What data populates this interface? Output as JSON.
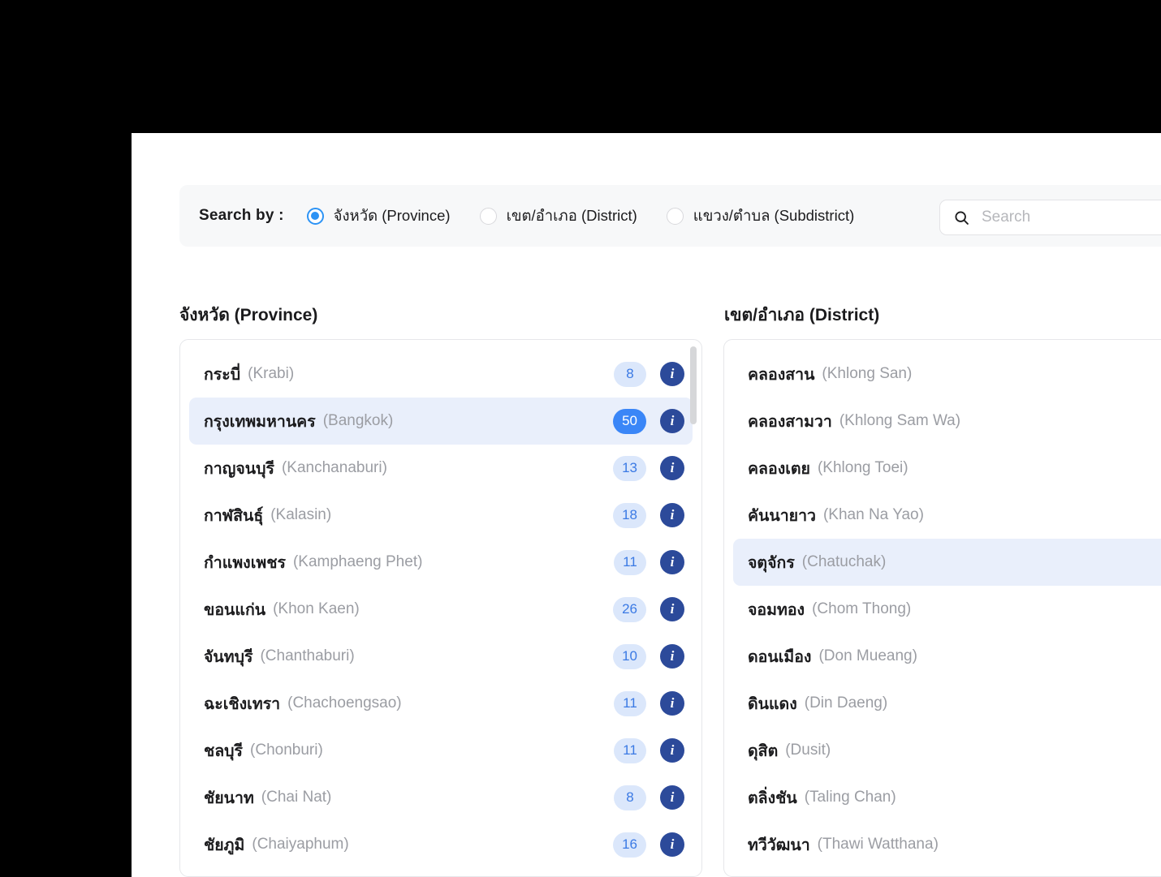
{
  "filter_bar": {
    "search_by_label": "Search by :",
    "options": [
      {
        "label": "จังหวัด (Province)",
        "checked": true
      },
      {
        "label": "เขต/อำเภอ (District)",
        "checked": false
      },
      {
        "label": "แขวง/ตำบล (Subdistrict)",
        "checked": false
      }
    ],
    "search": {
      "icon": "search-icon",
      "value": "",
      "placeholder": "Search"
    }
  },
  "province_column": {
    "title": "จังหวัด (Province)",
    "items": [
      {
        "th": "กระบี่",
        "en": "(Krabi)",
        "count": "8",
        "selected": false
      },
      {
        "th": "กรุงเทพมหานคร",
        "en": "(Bangkok)",
        "count": "50",
        "selected": true
      },
      {
        "th": "กาญจนบุรี",
        "en": "(Kanchanaburi)",
        "count": "13",
        "selected": false
      },
      {
        "th": "กาฬสินธุ์",
        "en": "(Kalasin)",
        "count": "18",
        "selected": false
      },
      {
        "th": "กำแพงเพชร",
        "en": "(Kamphaeng Phet)",
        "count": "11",
        "selected": false
      },
      {
        "th": "ขอนแก่น",
        "en": "(Khon Kaen)",
        "count": "26",
        "selected": false
      },
      {
        "th": "จันทบุรี",
        "en": "(Chanthaburi)",
        "count": "10",
        "selected": false
      },
      {
        "th": "ฉะเชิงเทรา",
        "en": "(Chachoengsao)",
        "count": "11",
        "selected": false
      },
      {
        "th": "ชลบุรี",
        "en": "(Chonburi)",
        "count": "11",
        "selected": false
      },
      {
        "th": "ชัยนาท",
        "en": "(Chai Nat)",
        "count": "8",
        "selected": false
      },
      {
        "th": "ชัยภูมิ",
        "en": "(Chaiyaphum)",
        "count": "16",
        "selected": false
      }
    ]
  },
  "district_column": {
    "title": "เขต/อำเภอ (District)",
    "items": [
      {
        "th": "คลองสาน",
        "en": "(Khlong San)",
        "selected": false
      },
      {
        "th": "คลองสามวา",
        "en": "(Khlong Sam Wa)",
        "selected": false
      },
      {
        "th": "คลองเตย",
        "en": "(Khlong Toei)",
        "selected": false
      },
      {
        "th": "คันนายาว",
        "en": "(Khan Na Yao)",
        "selected": false
      },
      {
        "th": "จตุจักร",
        "en": "(Chatuchak)",
        "selected": true
      },
      {
        "th": "จอมทอง",
        "en": "(Chom Thong)",
        "selected": false
      },
      {
        "th": "ดอนเมือง",
        "en": "(Don Mueang)",
        "selected": false
      },
      {
        "th": "ดินแดง",
        "en": "(Din Daeng)",
        "selected": false
      },
      {
        "th": "ดุสิต",
        "en": "(Dusit)",
        "selected": false
      },
      {
        "th": "ตลิ่งชัน",
        "en": "(Taling Chan)",
        "selected": false
      },
      {
        "th": "ทวีวัฒนา",
        "en": "(Thawi Watthana)",
        "selected": false
      }
    ]
  },
  "colors": {
    "accent_blue": "#2c93f5",
    "badge_bg": "#dbe7fb",
    "badge_text": "#3b7ae4",
    "badge_selected_bg": "#3a86f7",
    "info_icon_bg": "#2c4a9a",
    "row_selected_bg": "#e9effb",
    "filter_bar_bg": "#f7f8f9"
  }
}
